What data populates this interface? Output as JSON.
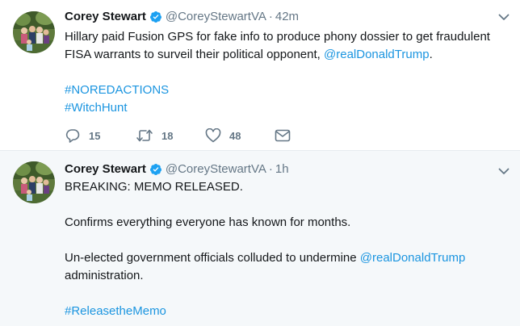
{
  "tweets": [
    {
      "fullname": "Corey Stewart",
      "handle": "@CoreyStewartVA",
      "separator": "·",
      "time": "42m",
      "lines": [
        [
          {
            "t": "Hillary paid Fusion GPS for fake info to produce phony dossier to get fraudulent"
          }
        ],
        [
          {
            "t": "FISA warrants to surveil their political opponent, "
          },
          {
            "t": "@realDonaldTrump",
            "k": "mention"
          },
          {
            "t": "."
          }
        ],
        [],
        [
          {
            "t": "#NOREDACTIONS",
            "k": "hashtag"
          }
        ],
        [
          {
            "t": "#WitchHunt",
            "k": "hashtag"
          }
        ]
      ],
      "actions": {
        "reply_count": "15",
        "retweet_count": "18",
        "like_count": "48"
      }
    },
    {
      "fullname": "Corey Stewart",
      "handle": "@CoreyStewartVA",
      "separator": "·",
      "time": "1h",
      "lines": [
        [
          {
            "t": "BREAKING: MEMO RELEASED."
          }
        ],
        [],
        [
          {
            "t": "Confirms everything everyone has known for months."
          }
        ],
        [],
        [
          {
            "t": "Un-elected government officials colluded to undermine "
          },
          {
            "t": "@realDonaldTrump",
            "k": "mention"
          }
        ],
        [
          {
            "t": "administration."
          }
        ],
        [],
        [
          {
            "t": "#ReleasetheMemo",
            "k": "hashtag"
          }
        ]
      ]
    }
  ],
  "colors": {
    "link": "#1b95e0",
    "verified": "#1da1f2",
    "muted": "#657786",
    "text": "#14171a",
    "divider": "#e6ecf0",
    "second_tweet_bg": "#f5f8fa"
  },
  "icons": [
    "verified-badge-icon",
    "chevron-down-icon",
    "reply-icon",
    "retweet-icon",
    "like-icon",
    "direct-message-icon"
  ]
}
